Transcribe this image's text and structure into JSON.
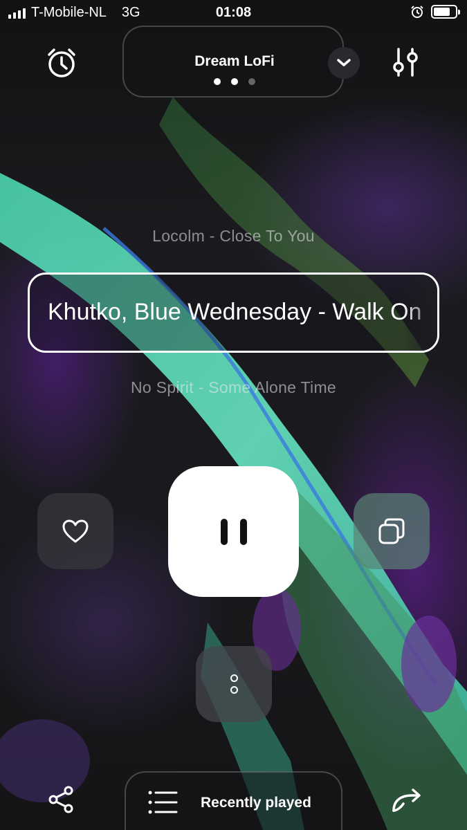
{
  "status_bar": {
    "carrier": "T-Mobile-NL",
    "network": "3G",
    "time": "01:08",
    "battery_level": 0.75
  },
  "header": {
    "station_name": "Dream LoFi",
    "page_count": 3,
    "active_page": 2,
    "icons": {
      "left": "alarm-clock-icon",
      "dropdown": "chevron-down-icon",
      "right": "equalizer-sliders-icon"
    }
  },
  "tracks": {
    "previous": "Locolm - Close To You",
    "current": "Khutko, Blue Wednesday - Walk On",
    "next": "No Spirit - Some Alone Time"
  },
  "controls": {
    "like_icon": "heart-icon",
    "play_state_icon": "pause-icon",
    "copy_icon": "copy-icon",
    "more_icon": "more-dots-icon"
  },
  "bottom_bar": {
    "share_icon": "share-icon",
    "list_icon": "list-icon",
    "recently_played_label": "Recently played",
    "repost_icon": "repost-arrow-icon"
  },
  "colors": {
    "accent_teal": "#5fe8c4",
    "accent_purple": "#5a2a8c",
    "play_button": "#ffffff"
  }
}
